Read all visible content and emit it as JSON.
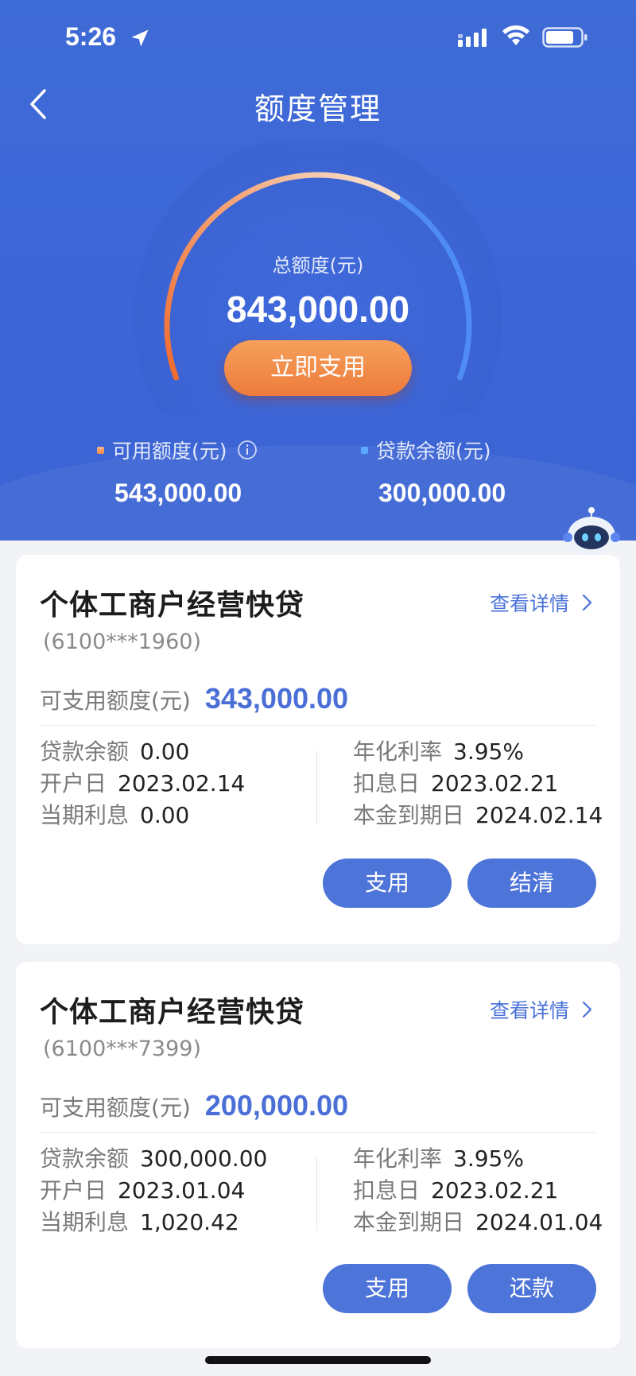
{
  "status_bar": {
    "time": "5:26"
  },
  "header": {
    "title": "额度管理"
  },
  "summary": {
    "total_label": "总额度(元)",
    "total_value": "843,000.00",
    "use_now_label": "立即支用",
    "available_label": "可用额度(元)",
    "available_value": "543,000.00",
    "balance_label": "贷款余额(元)",
    "balance_value": "300,000.00",
    "used_fraction": 0.356
  },
  "loans": [
    {
      "title": "个体工商户经营快贷",
      "account": "(6100***1960)",
      "detail_label": "查看详情",
      "avail_label": "可支用额度(元)",
      "avail_value": "343,000.00",
      "balance_label": "贷款余额",
      "balance_value": "0.00",
      "open_label": "开户日",
      "open_value": "2023.02.14",
      "interest_label": "当期利息",
      "interest_value": "0.00",
      "rate_label": "年化利率",
      "rate_value": "3.95%",
      "deduct_label": "扣息日",
      "deduct_value": "2023.02.21",
      "due_label": "本金到期日",
      "due_value": "2024.02.14",
      "btn_primary": "支用",
      "btn_secondary": "结清"
    },
    {
      "title": "个体工商户经营快贷",
      "account": "(6100***7399)",
      "detail_label": "查看详情",
      "avail_label": "可支用额度(元)",
      "avail_value": "200,000.00",
      "balance_label": "贷款余额",
      "balance_value": "300,000.00",
      "open_label": "开户日",
      "open_value": "2023.01.04",
      "interest_label": "当期利息",
      "interest_value": "1,020.42",
      "rate_label": "年化利率",
      "rate_value": "3.95%",
      "deduct_label": "扣息日",
      "deduct_value": "2023.02.21",
      "due_label": "本金到期日",
      "due_value": "2024.01.04",
      "btn_primary": "支用",
      "btn_secondary": "还款"
    }
  ],
  "colors": {
    "hero": "#3c66d8",
    "accent_blue": "#4a6fd6",
    "button_blue": "#4d74d8",
    "orange": "#ee7b3c"
  }
}
